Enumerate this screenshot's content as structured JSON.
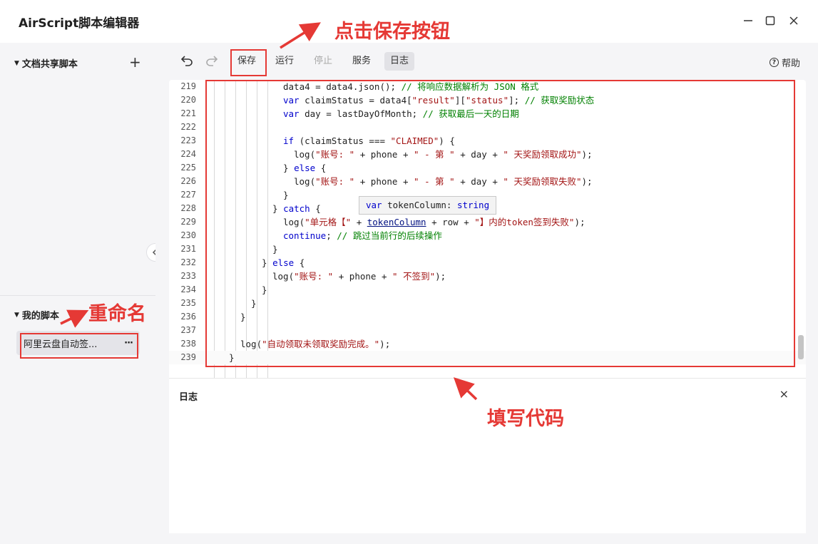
{
  "window": {
    "title": "AirScript脚本编辑器",
    "controls": [
      "minimize",
      "maximize",
      "close"
    ]
  },
  "sidebar": {
    "shared_section": "文档共享脚本",
    "my_section": "我的脚本",
    "scripts": [
      {
        "name": "阿里云盘自动签...",
        "more": "···"
      }
    ]
  },
  "toolbar": {
    "save": "保存",
    "run": "运行",
    "stop": "停止",
    "service": "服务",
    "log": "日志",
    "help": "帮助",
    "undo_icon": "undo-icon",
    "redo_icon": "redo-icon"
  },
  "editor": {
    "lines": [
      {
        "n": "219",
        "text": "data4 = data4.json(); // 将响应数据解析为 JSON 格式"
      },
      {
        "n": "220",
        "text": "var claimStatus = data4[\"result\"][\"status\"]; // 获取奖励状态"
      },
      {
        "n": "221",
        "text": "var day = lastDayOfMonth; // 获取最后一天的日期"
      },
      {
        "n": "222",
        "text": ""
      },
      {
        "n": "223",
        "text": "if (claimStatus === \"CLAIMED\") {"
      },
      {
        "n": "224",
        "text": "log(\"账号: \" + phone + \" - 第 \" + day + \" 天奖励领取成功\");"
      },
      {
        "n": "225",
        "text": "} else {"
      },
      {
        "n": "226",
        "text": "log(\"账号: \" + phone + \" - 第 \" + day + \" 天奖励领取失败\");"
      },
      {
        "n": "227",
        "text": "}"
      },
      {
        "n": "228",
        "text": "} catch {"
      },
      {
        "n": "229",
        "text": "log(\"单元格【\" + tokenColumn + row + \"】内的token签到失败\");"
      },
      {
        "n": "230",
        "text": "continue; // 跳过当前行的后续操作"
      },
      {
        "n": "231",
        "text": "}"
      },
      {
        "n": "232",
        "text": "} else {"
      },
      {
        "n": "233",
        "text": "log(\"账号: \" + phone + \" 不签到\");"
      },
      {
        "n": "234",
        "text": "}"
      },
      {
        "n": "235",
        "text": "}"
      },
      {
        "n": "236",
        "text": "}"
      },
      {
        "n": "237",
        "text": ""
      },
      {
        "n": "238",
        "text": "log(\"自动领取未领取奖励完成。\");"
      },
      {
        "n": "239",
        "text": "}"
      }
    ],
    "hover_tooltip": "var tokenColumn: string"
  },
  "log_panel": {
    "title": "日志",
    "close": "×"
  },
  "annotations": {
    "save": "点击保存按钮",
    "rename": "重命名",
    "code": "填写代码",
    "color": "#e53935"
  }
}
